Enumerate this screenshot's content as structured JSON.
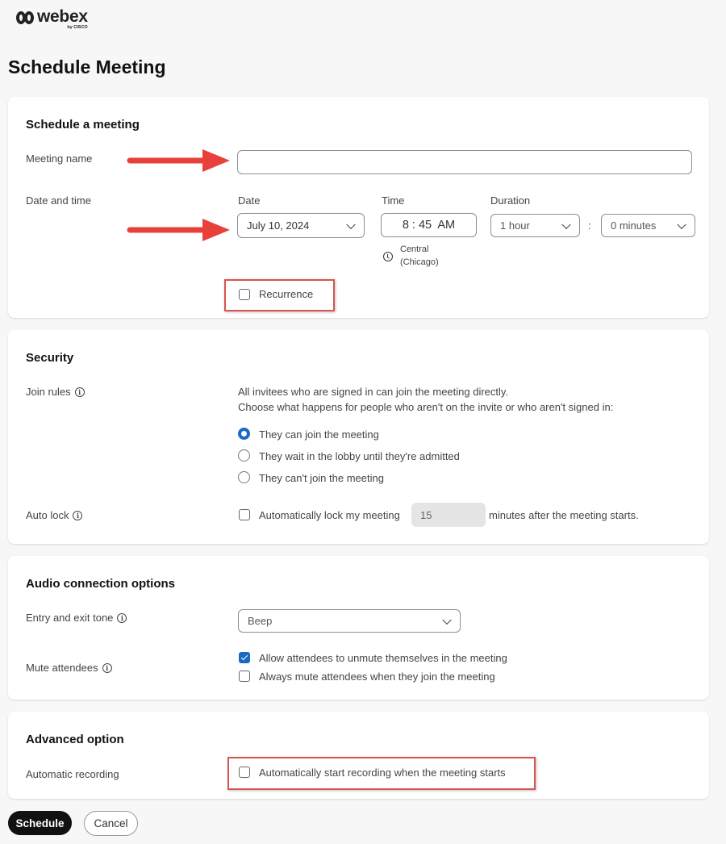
{
  "app": {
    "logo_word": "webex",
    "logo_by": "by CISCO",
    "page_title": "Schedule Meeting"
  },
  "schedule": {
    "title": "Schedule a meeting",
    "meeting_name_label": "Meeting name",
    "meeting_name_value": "",
    "date_time_label": "Date and time",
    "date_label": "Date",
    "date_value": "July 10, 2024",
    "time_label": "Time",
    "time_value": "8 : 45  AM",
    "timezone_line1": "Central",
    "timezone_line2": "(Chicago)",
    "duration_label": "Duration",
    "duration_hours": "1 hour",
    "duration_separator": ":",
    "duration_minutes": "0 minutes",
    "recurrence_label": "Recurrence",
    "recurrence_checked": false
  },
  "security": {
    "title": "Security",
    "join_rules_label": "Join rules",
    "join_rules_desc1": "All invitees who are signed in can join the meeting directly.",
    "join_rules_desc2": "Choose what happens for people who aren't on the invite or who aren't signed in:",
    "options": [
      {
        "label": "They can join the meeting",
        "selected": true
      },
      {
        "label": "They wait in the lobby until they're admitted",
        "selected": false
      },
      {
        "label": "They can't join the meeting",
        "selected": false
      }
    ],
    "auto_lock_label": "Auto lock",
    "auto_lock_text": "Automatically lock my meeting",
    "auto_lock_minutes": "15",
    "auto_lock_suffix": "minutes after the meeting starts.",
    "auto_lock_checked": false
  },
  "audio": {
    "title": "Audio connection options",
    "tone_label": "Entry and exit tone",
    "tone_value": "Beep",
    "mute_label": "Mute attendees",
    "mute_options": [
      {
        "label": "Allow attendees to unmute themselves in the meeting",
        "checked": true
      },
      {
        "label": "Always mute attendees when they join the meeting",
        "checked": false
      }
    ]
  },
  "advanced": {
    "title": "Advanced option",
    "recording_label": "Automatic recording",
    "recording_text": "Automatically start recording when the meeting starts",
    "recording_checked": false
  },
  "actions": {
    "schedule_label": "Schedule",
    "cancel_label": "Cancel"
  },
  "colors": {
    "accent": "#1a6ac4",
    "annotation": "#e8413b",
    "primary_button": "#111111"
  }
}
